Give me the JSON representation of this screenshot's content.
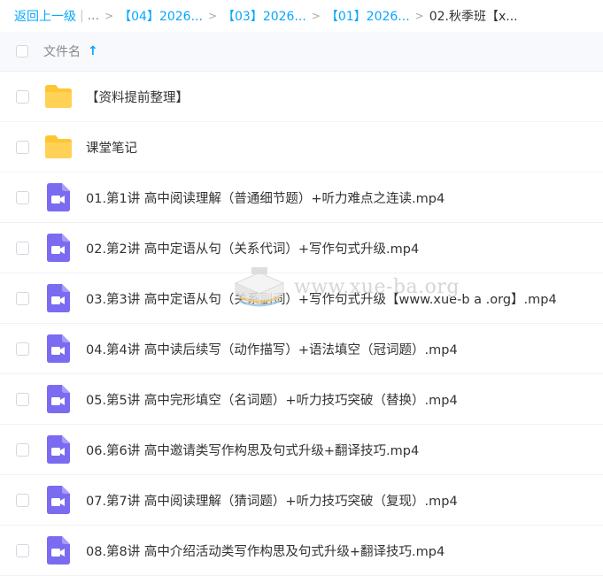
{
  "breadcrumb": {
    "back_label": "返回上一级",
    "separator": "|",
    "more": "...",
    "arrow": ">",
    "crumbs": [
      "【04】2026...",
      "【03】2026...",
      "【01】2026..."
    ],
    "current": "02.秋季班【x..."
  },
  "header": {
    "column_name": "文件名",
    "sort_icon": "↑"
  },
  "files": [
    {
      "name": "【资料提前整理】",
      "type": "folder"
    },
    {
      "name": "课堂笔记",
      "type": "folder"
    },
    {
      "name": "01.第1讲 高中阅读理解（普通细节题）+听力难点之连读.mp4",
      "type": "video"
    },
    {
      "name": "02.第2讲 高中定语从句（关系代词）+写作句式升级.mp4",
      "type": "video"
    },
    {
      "name": "03.第3讲 高中定语从句（关系副词）+写作句式升级【www.xue-b a .org】.mp4",
      "type": "video"
    },
    {
      "name": "04.第4讲 高中读后续写（动作描写）+语法填空（冠词题）.mp4",
      "type": "video"
    },
    {
      "name": "05.第5讲 高中完形填空（名词题）+听力技巧突破（替换）.mp4",
      "type": "video"
    },
    {
      "name": "06.第6讲 高中邀请类写作构思及句式升级+翻译技巧.mp4",
      "type": "video"
    },
    {
      "name": "07.第7讲 高中阅读理解（猜词题）+听力技巧突破（复现）.mp4",
      "type": "video"
    },
    {
      "name": "08.第8讲 高中介绍活动类写作构思及句式升级+翻译技巧.mp4",
      "type": "video"
    }
  ],
  "watermark": {
    "text": "www.xue-ba.org"
  },
  "colors": {
    "accent": "#06a7ff",
    "folder": "#ffc533",
    "video": "#7b6bf0",
    "header_bg": "#f7f9fc"
  },
  "icons": {
    "folder": "folder-icon",
    "video": "video-file-icon",
    "sort": "arrow-up-icon"
  }
}
